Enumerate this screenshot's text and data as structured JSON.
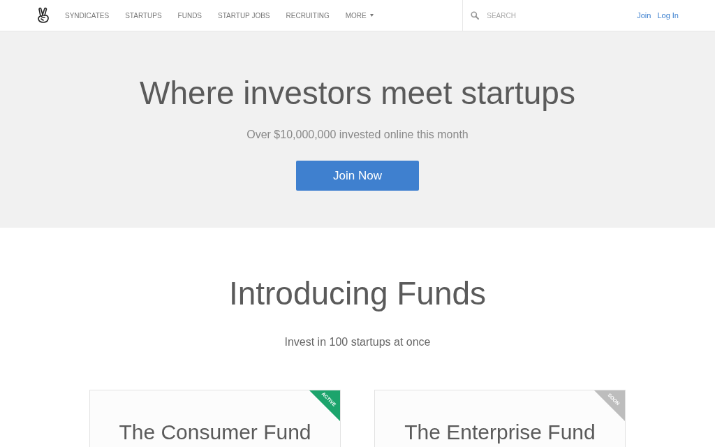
{
  "nav": {
    "items": [
      {
        "label": "SYNDICATES",
        "kind": "link"
      },
      {
        "label": "STARTUPS",
        "kind": "link"
      },
      {
        "label": "FUNDS",
        "kind": "link"
      },
      {
        "label": "STARTUP JOBS",
        "kind": "link"
      },
      {
        "label": "RECRUITING",
        "kind": "link"
      },
      {
        "label": "MORE",
        "kind": "dropdown"
      }
    ],
    "search": {
      "placeholder": "SEARCH"
    },
    "auth_links": [
      "Join",
      "Log In"
    ]
  },
  "hero": {
    "title": "Where investors meet startups",
    "subtitle": "Over $10,000,000 invested online this month",
    "button": "Join Now"
  },
  "funds": {
    "title": "Introducing Funds",
    "subtitle": "Invest in 100 startups at once",
    "cards": [
      {
        "title": "The Consumer Fund",
        "badge": {
          "label": "ACTIVE",
          "color": "#1ca46c"
        }
      },
      {
        "title": "The Enterprise Fund",
        "badge": {
          "label": "SOON",
          "color": "#bdbdbd"
        }
      }
    ]
  }
}
